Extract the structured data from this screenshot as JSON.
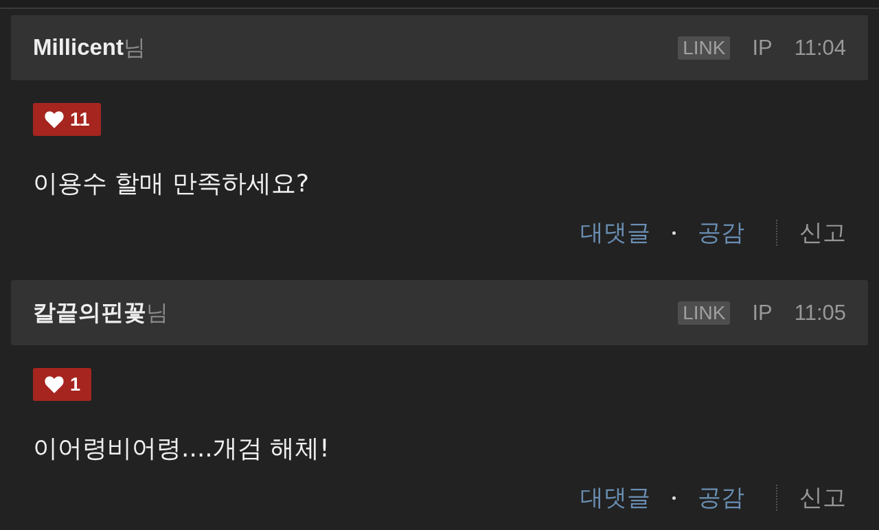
{
  "comments": [
    {
      "author": "Millicent",
      "suffix": "님",
      "link_label": "LINK",
      "ip": "IP",
      "time": "11:04",
      "likes": "11",
      "body": "이용수 할매 만족하세요?",
      "reply": "대댓글",
      "empathy": "공감",
      "report": "신고"
    },
    {
      "author": "칼끝의핀꽃",
      "suffix": "님",
      "link_label": "LINK",
      "ip": "IP",
      "time": "11:05",
      "likes": "1",
      "body": "이어령비어령....개검 해체!",
      "reply": "대댓글",
      "empathy": "공감",
      "report": "신고"
    }
  ]
}
